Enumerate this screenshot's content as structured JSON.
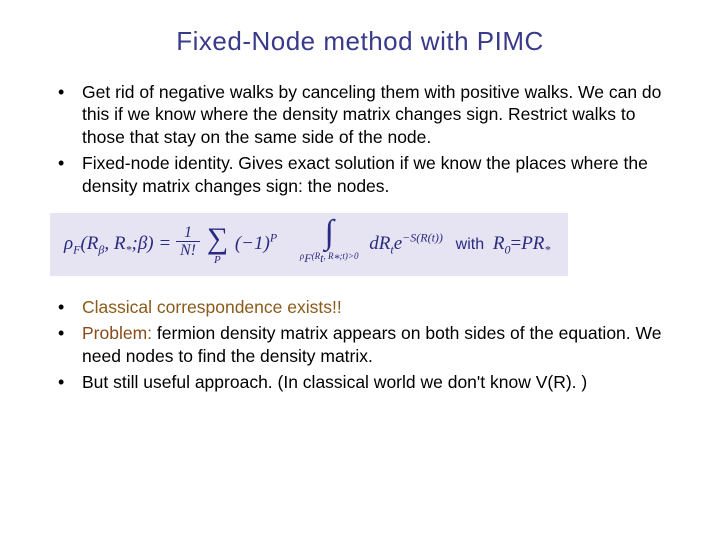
{
  "title": "Fixed-Node method with PIMC",
  "bullets_top": [
    "Get rid of negative walks by canceling them with positive walks. We can do this if we know where the density matrix changes sign. Restrict walks to those that stay on the same side of the node.",
    "Fixed-node identity. Gives exact solution if we know the places where the density matrix changes sign: the nodes."
  ],
  "equation": {
    "lhs_rho": "ρ",
    "lhs_sub": "F",
    "lhs_args": "(R",
    "lhs_beta": "β",
    "lhs_rest": ", R",
    "lhs_star": "*",
    "lhs_close": ";β)",
    "eq": "=",
    "frac_num": "1",
    "frac_den": "N!",
    "sum_sub": "P",
    "minus1": "(−1)",
    "minus1_sup": "P",
    "int_sub": "ρ",
    "int_sub_f": "F",
    "int_sub_args": "(R",
    "int_sub_t": "t",
    "int_sub_rest": ", R",
    "int_sub_star": "*",
    "int_sub_close": ";t)>0",
    "dR": "dR",
    "dR_sub": "t",
    "e": "e",
    "exp": "−S(R(t))",
    "with": "with",
    "R0": "R",
    "R0_sub": "0",
    "eq2": "=",
    "PR": "PR",
    "PR_sub": "*"
  },
  "bullets_bottom": [
    {
      "pre": "",
      "accent": "Classical correspondence exists!!",
      "post": ""
    },
    {
      "pre": "",
      "accent": "Problem:",
      "post": " fermion density matrix appears on both sides of the equation.  We need nodes to find the density matrix."
    },
    {
      "pre": "But still useful approach. (In classical world we don't know V(R). )",
      "accent": "",
      "post": ""
    }
  ]
}
